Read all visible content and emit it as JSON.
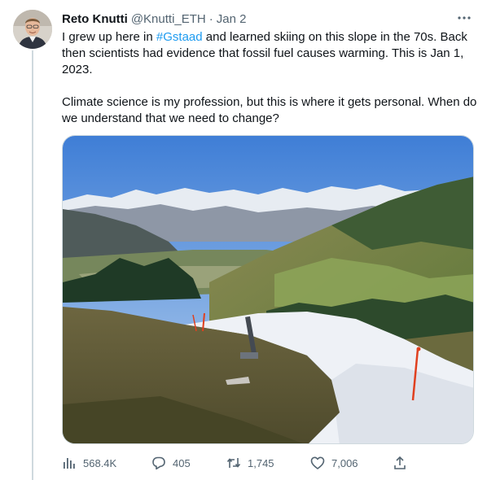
{
  "tweet": {
    "author_name": "Reto Knutti",
    "author_handle": "@Knutti_ETH",
    "separator": "·",
    "date": "Jan 2",
    "text_p1_a": "I grew up here in ",
    "hashtag": "#Gstaad",
    "text_p1_b": " and learned skiing on this slope in the 70s. Back then scientists had evidence that fossil fuel causes warming. This is Jan 1, 2023.",
    "text_p2": "Climate science is my profession, but this is where it gets personal. When do we understand that we need to change?",
    "media_alt": "Photo of a grassy ski slope near Gstaad with only a thin strip of snow, mountains in the background"
  },
  "actions": {
    "views": "568.4K",
    "replies": "405",
    "retweets": "1,745",
    "likes": "7,006"
  },
  "icons": {
    "more": "more-icon",
    "views": "views-icon",
    "reply": "reply-icon",
    "retweet": "retweet-icon",
    "like": "like-icon",
    "share": "share-icon"
  },
  "colors": {
    "link": "#1d9bf0",
    "secondary_text": "#536471",
    "primary_text": "#0f1419",
    "thread_line": "#cfd9de"
  }
}
